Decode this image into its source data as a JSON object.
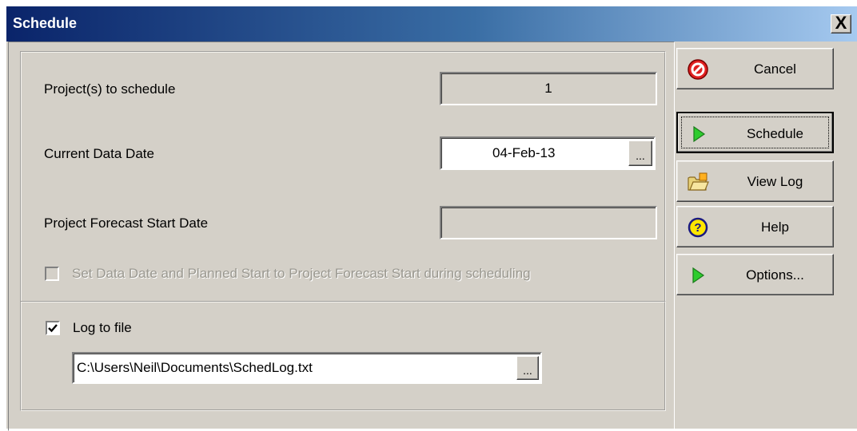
{
  "window": {
    "title": "Schedule",
    "close_label": "X"
  },
  "form": {
    "projects_label": "Project(s) to schedule",
    "projects_value": "1",
    "data_date_label": "Current Data Date",
    "data_date_value": "04-Feb-13",
    "ellipsis": "...",
    "forecast_label": "Project Forecast Start Date",
    "forecast_value": "",
    "set_data_date_label": "Set Data Date and Planned Start to Project Forecast Start during scheduling",
    "set_data_date_checked": false,
    "set_data_date_enabled": false,
    "log_to_file_label": "Log to file",
    "log_to_file_checked": true,
    "log_path": "C:\\Users\\Neil\\Documents\\SchedLog.txt"
  },
  "buttons": [
    {
      "label": "Cancel",
      "icon": "cancel-icon"
    },
    {
      "label": "Schedule",
      "icon": "play-icon"
    },
    {
      "label": "View Log",
      "icon": "folder-icon"
    },
    {
      "label": "Help",
      "icon": "help-icon"
    },
    {
      "label": "Options...",
      "icon": "play-icon"
    }
  ],
  "colors": {
    "title_gradient_start": "#0a246a",
    "title_gradient_end": "#a6caf0",
    "face": "#d4d0c8"
  }
}
